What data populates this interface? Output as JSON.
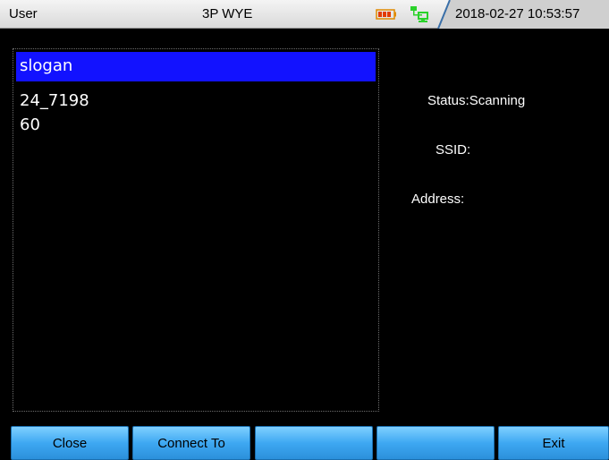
{
  "header": {
    "user": "User",
    "mode": "3P WYE",
    "datetime": "2018-02-27 10:53:57",
    "battery_icon": "battery-icon",
    "network_icon": "network-icon",
    "colors": {
      "battery": "#e23b00",
      "network": "#2bd22b",
      "bar": "#e6e6e6"
    }
  },
  "list": {
    "items": [
      "slogan",
      "24_7198",
      "60"
    ],
    "selected_index": 0,
    "selection_color": "#1212ff"
  },
  "info": {
    "status_label": "Status:Scanning",
    "ssid_label": "SSID:",
    "address_label": "Address:"
  },
  "footer": {
    "buttons": [
      "Close",
      "Connect To",
      "",
      "",
      "Exit"
    ],
    "color": "#3ea8f2"
  }
}
